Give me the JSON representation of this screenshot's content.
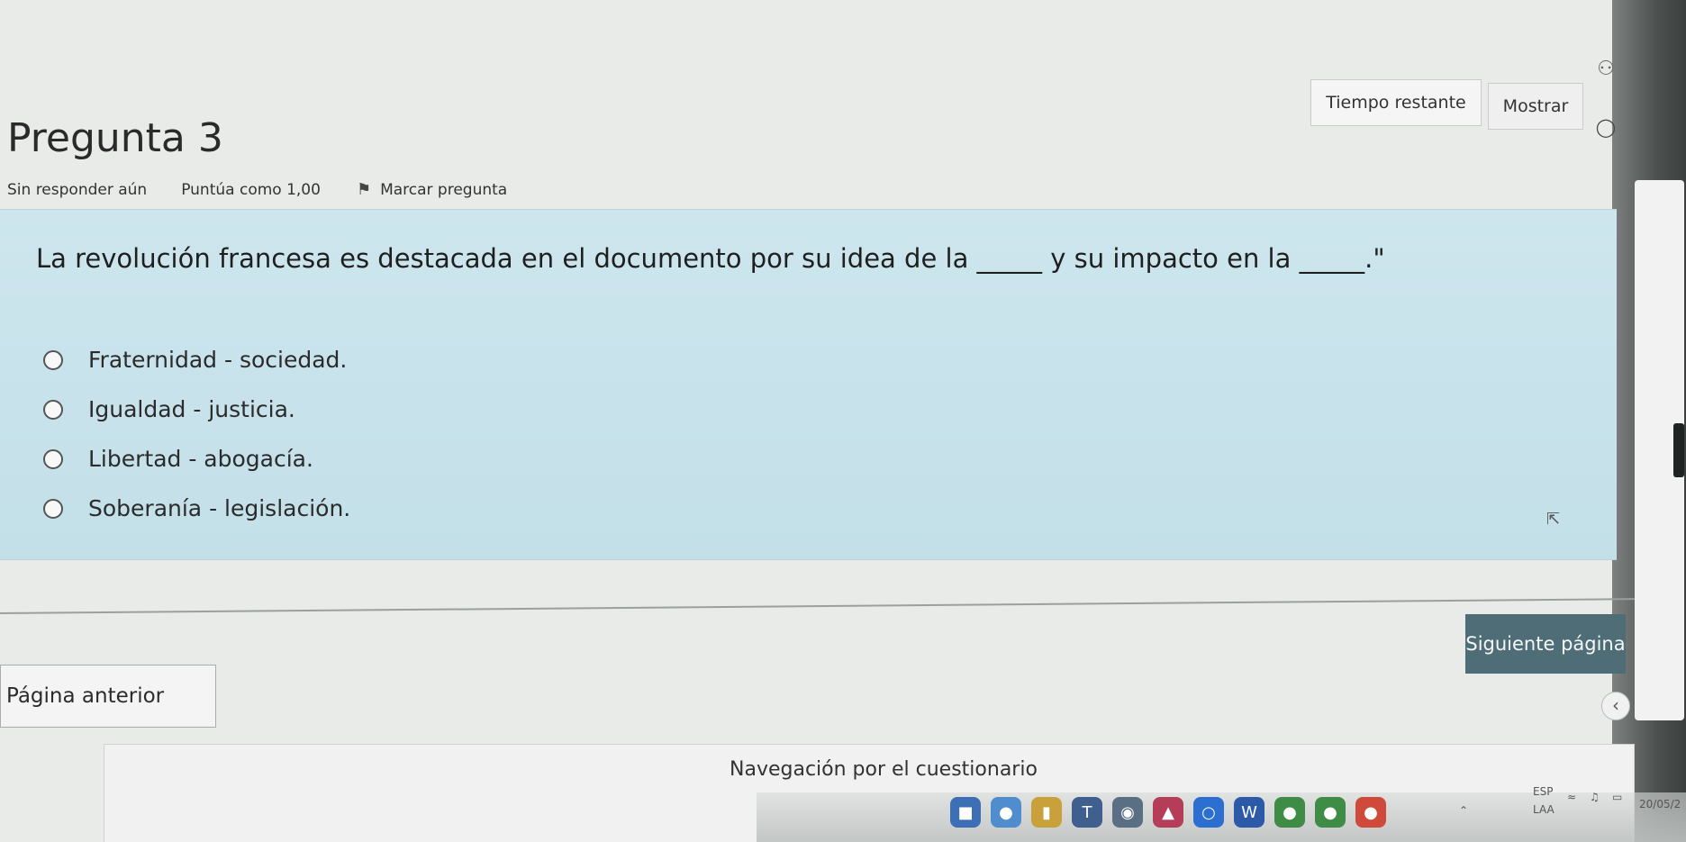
{
  "header": {
    "question_title": "Pregunta 3",
    "status": "Sin responder aún",
    "points": "Puntúa como 1,00",
    "flag_label": "Marcar pregunta",
    "timer_label": "Tiempo restante",
    "show_button": "Mostrar"
  },
  "question": {
    "text": "La revolución francesa es destacada en el documento por su idea de la _____ y su impacto en la _____.\"",
    "answers": [
      "Fraternidad - sociedad.",
      "Igualdad - justicia.",
      "Libertad - abogacía.",
      "Soberanía - legislación."
    ]
  },
  "navigation": {
    "next_button": "Siguiente página",
    "prev_button": "Página anterior",
    "quiz_nav_title": "Navegación por el cuestionario"
  },
  "taskbar": {
    "lang_top": "ESP",
    "lang_bottom": "LAA",
    "date_partial": "20/05/2"
  },
  "colors": {
    "panel": "#c9e3eb",
    "next_button_bg": "#4f6d77"
  }
}
